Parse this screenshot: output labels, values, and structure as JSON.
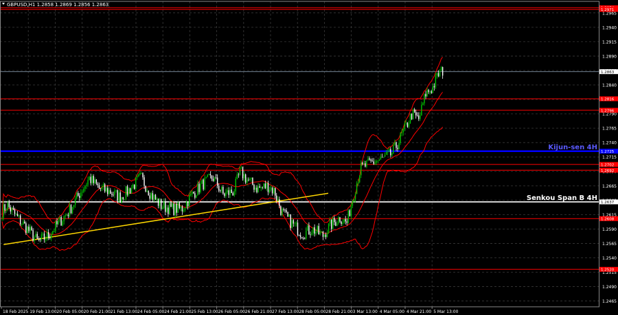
{
  "window": {
    "symbol_header": "GBPUSD,H1  1.2858 1.2869 1.2856 1.2863"
  },
  "colors": {
    "background": "#000000",
    "grid": "#3a3a3a",
    "bull_candle": "#00c800",
    "bear_candle": "#ffffff",
    "bollinger": "#ff0000",
    "trendline": "#ffd700",
    "kijun": "#0000ff",
    "senkou": "#ffffff",
    "level_line": "#ff0000",
    "current_price_line": "#708090",
    "price_tag_bg": "#ff0000",
    "axis_text": "#ffffff"
  },
  "chart_data": {
    "type": "candlestick",
    "title": "",
    "y_ticks": [
      "1.2965",
      "1.2940",
      "1.2915",
      "1.2890",
      "1.2865",
      "1.2840",
      "1.2815",
      "1.2790",
      "1.2765",
      "1.2740",
      "1.2715",
      "1.2690",
      "1.2665",
      "1.2640",
      "1.2615",
      "1.2590",
      "1.2565",
      "1.2540",
      "1.2515",
      "1.2490",
      "1.2465"
    ],
    "ylim": [
      1.2455,
      1.2985
    ],
    "x_ticks": [
      "18 Feb 2025",
      "19 Feb 13:00",
      "20 Feb 05:00",
      "20 Feb 21:00",
      "21 Feb 13:00",
      "24 Feb 05:00",
      "24 Feb 21:00",
      "25 Feb 13:00",
      "26 Feb 05:00",
      "26 Feb 21:00",
      "27 Feb 13:00",
      "28 Feb 05:00",
      "28 Feb 21:00",
      "3 Mar 13:00",
      "4 Mar 05:00",
      "4 Mar 21:00",
      "5 Mar 13:00"
    ],
    "price_levels": [
      {
        "label": "1.2974",
        "value": 1.2974
      },
      {
        "label": "1.2971",
        "value": 1.2971
      },
      {
        "label": "1.2816",
        "value": 1.2816
      },
      {
        "label": "1.2796",
        "value": 1.2796
      },
      {
        "label": "1.2702",
        "value": 1.2702
      },
      {
        "label": "1.2692",
        "value": 1.2692
      },
      {
        "label": "1.2608",
        "value": 1.2608
      },
      {
        "label": "1.2520",
        "value": 1.252
      }
    ],
    "kijun": {
      "label": "Kijun-sen 4H",
      "price_tag": "1.2725",
      "value": 1.2725
    },
    "senkou": {
      "label": "Senkou Span B 4H",
      "price_tag": "1.2637",
      "value": 1.2637
    },
    "current_price": {
      "label": "1.2863",
      "value": 1.2863
    },
    "trendline": {
      "from": {
        "x_index": 7,
        "price": 1.2563
      },
      "to": {
        "x_index": 630,
        "price": 1.2652
      }
    },
    "candles_anchor_path": [
      [
        0,
        1.2615
      ],
      [
        10,
        1.2632
      ],
      [
        25,
        1.261
      ],
      [
        40,
        1.259
      ],
      [
        55,
        1.2568
      ],
      [
        70,
        1.2578
      ],
      [
        85,
        1.26
      ],
      [
        100,
        1.262
      ],
      [
        115,
        1.265
      ],
      [
        130,
        1.2678
      ],
      [
        145,
        1.266
      ],
      [
        160,
        1.2655
      ],
      [
        175,
        1.2645
      ],
      [
        190,
        1.266
      ],
      [
        205,
        1.268
      ],
      [
        220,
        1.265
      ],
      [
        235,
        1.263
      ],
      [
        250,
        1.2625
      ],
      [
        265,
        1.2625
      ],
      [
        280,
        1.265
      ],
      [
        295,
        1.2668
      ],
      [
        310,
        1.268
      ],
      [
        325,
        1.265
      ],
      [
        340,
        1.2655
      ],
      [
        350,
        1.269
      ],
      [
        360,
        1.2675
      ],
      [
        375,
        1.266
      ],
      [
        390,
        1.2665
      ],
      [
        400,
        1.2655
      ],
      [
        410,
        1.262
      ],
      [
        425,
        1.26
      ],
      [
        440,
        1.2582
      ],
      [
        455,
        1.259
      ],
      [
        470,
        1.2578
      ],
      [
        480,
        1.2595
      ],
      [
        495,
        1.261
      ],
      [
        505,
        1.26
      ],
      [
        515,
        1.265
      ],
      [
        525,
        1.2695
      ],
      [
        540,
        1.2705
      ],
      [
        555,
        1.271
      ],
      [
        570,
        1.272
      ],
      [
        580,
        1.274
      ],
      [
        590,
        1.2765
      ],
      [
        600,
        1.279
      ],
      [
        610,
        1.278
      ],
      [
        620,
        1.2825
      ],
      [
        630,
        1.2835
      ],
      [
        638,
        1.2858
      ],
      [
        645,
        1.2865
      ]
    ]
  }
}
